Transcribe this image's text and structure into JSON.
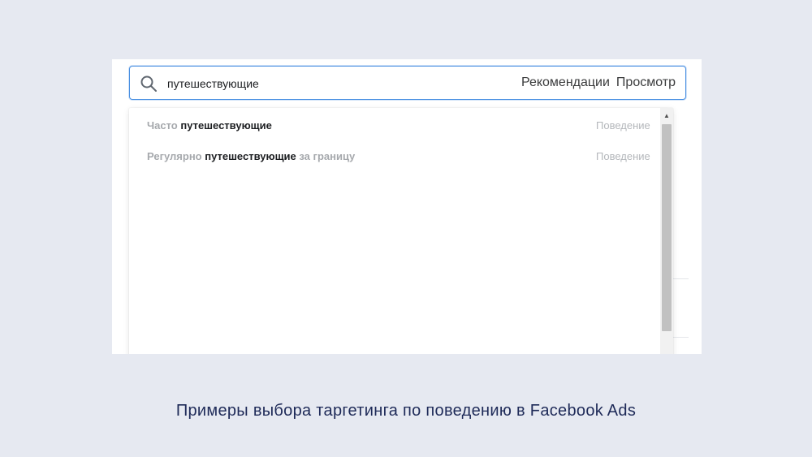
{
  "search": {
    "query": "путешествующие",
    "tabs": [
      "Рекомендации",
      "Просмотр"
    ]
  },
  "results": [
    {
      "segments": [
        {
          "text": "Часто ",
          "style": "muted"
        },
        {
          "text": "путешествующие",
          "style": "strong"
        }
      ],
      "category": "Поведение"
    },
    {
      "segments": [
        {
          "text": "Регулярно ",
          "style": "muted"
        },
        {
          "text": "путешествующие",
          "style": "strong"
        },
        {
          "text": " за границу",
          "style": "muted"
        }
      ],
      "category": "Поведение"
    }
  ],
  "caption": "Примеры выбора таргетинга по поведению в Facebook Ads",
  "colors": {
    "page_bg": "#e6e9f1",
    "focus_border": "#4a90e2",
    "caption": "#1e2a58"
  },
  "icons": {
    "search": "search-icon",
    "scroll_up": "scroll-up-arrow-icon",
    "scroll_down": "scroll-down-arrow-icon"
  }
}
